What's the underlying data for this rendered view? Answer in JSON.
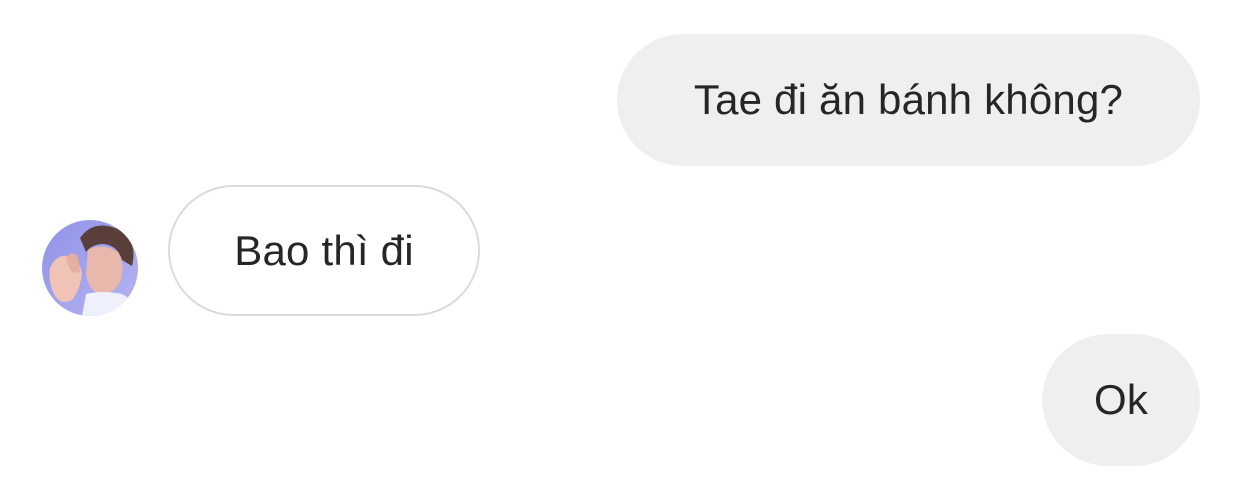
{
  "conversation": {
    "messages": [
      {
        "sender": "me",
        "text": "Tae đi ăn bánh không?"
      },
      {
        "sender": "other",
        "text": "Bao thì đi"
      },
      {
        "sender": "me",
        "text": "Ok"
      }
    ],
    "other_participant": {
      "avatar": "profile-photo"
    }
  },
  "colors": {
    "outgoing_bubble": "#efefef",
    "incoming_border": "#dbdbdb",
    "text": "#262626",
    "background": "#ffffff"
  }
}
